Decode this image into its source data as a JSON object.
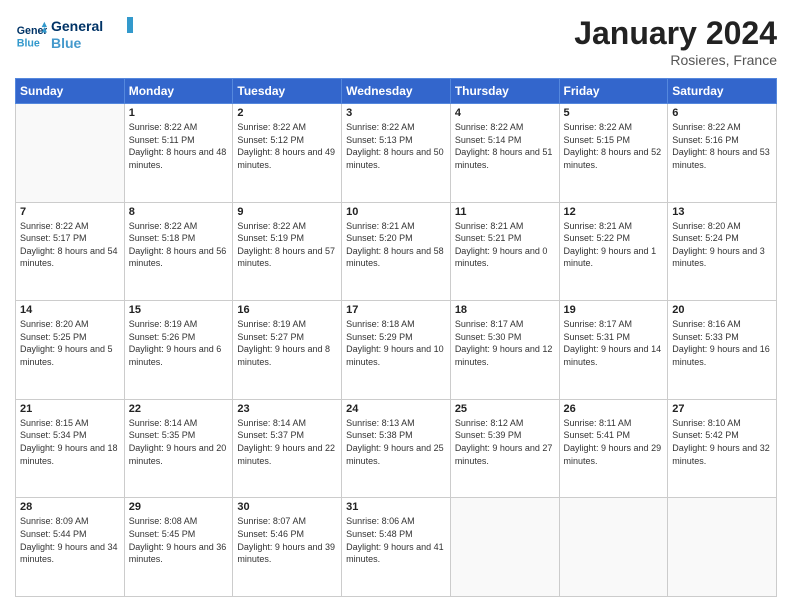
{
  "logo": {
    "line1": "General",
    "line2": "Blue"
  },
  "header": {
    "title": "January 2024",
    "location": "Rosieres, France"
  },
  "days_of_week": [
    "Sunday",
    "Monday",
    "Tuesday",
    "Wednesday",
    "Thursday",
    "Friday",
    "Saturday"
  ],
  "weeks": [
    [
      {
        "day": "",
        "sunrise": "",
        "sunset": "",
        "daylight": ""
      },
      {
        "day": "1",
        "sunrise": "Sunrise: 8:22 AM",
        "sunset": "Sunset: 5:11 PM",
        "daylight": "Daylight: 8 hours and 48 minutes."
      },
      {
        "day": "2",
        "sunrise": "Sunrise: 8:22 AM",
        "sunset": "Sunset: 5:12 PM",
        "daylight": "Daylight: 8 hours and 49 minutes."
      },
      {
        "day": "3",
        "sunrise": "Sunrise: 8:22 AM",
        "sunset": "Sunset: 5:13 PM",
        "daylight": "Daylight: 8 hours and 50 minutes."
      },
      {
        "day": "4",
        "sunrise": "Sunrise: 8:22 AM",
        "sunset": "Sunset: 5:14 PM",
        "daylight": "Daylight: 8 hours and 51 minutes."
      },
      {
        "day": "5",
        "sunrise": "Sunrise: 8:22 AM",
        "sunset": "Sunset: 5:15 PM",
        "daylight": "Daylight: 8 hours and 52 minutes."
      },
      {
        "day": "6",
        "sunrise": "Sunrise: 8:22 AM",
        "sunset": "Sunset: 5:16 PM",
        "daylight": "Daylight: 8 hours and 53 minutes."
      }
    ],
    [
      {
        "day": "7",
        "sunrise": "Sunrise: 8:22 AM",
        "sunset": "Sunset: 5:17 PM",
        "daylight": "Daylight: 8 hours and 54 minutes."
      },
      {
        "day": "8",
        "sunrise": "Sunrise: 8:22 AM",
        "sunset": "Sunset: 5:18 PM",
        "daylight": "Daylight: 8 hours and 56 minutes."
      },
      {
        "day": "9",
        "sunrise": "Sunrise: 8:22 AM",
        "sunset": "Sunset: 5:19 PM",
        "daylight": "Daylight: 8 hours and 57 minutes."
      },
      {
        "day": "10",
        "sunrise": "Sunrise: 8:21 AM",
        "sunset": "Sunset: 5:20 PM",
        "daylight": "Daylight: 8 hours and 58 minutes."
      },
      {
        "day": "11",
        "sunrise": "Sunrise: 8:21 AM",
        "sunset": "Sunset: 5:21 PM",
        "daylight": "Daylight: 9 hours and 0 minutes."
      },
      {
        "day": "12",
        "sunrise": "Sunrise: 8:21 AM",
        "sunset": "Sunset: 5:22 PM",
        "daylight": "Daylight: 9 hours and 1 minute."
      },
      {
        "day": "13",
        "sunrise": "Sunrise: 8:20 AM",
        "sunset": "Sunset: 5:24 PM",
        "daylight": "Daylight: 9 hours and 3 minutes."
      }
    ],
    [
      {
        "day": "14",
        "sunrise": "Sunrise: 8:20 AM",
        "sunset": "Sunset: 5:25 PM",
        "daylight": "Daylight: 9 hours and 5 minutes."
      },
      {
        "day": "15",
        "sunrise": "Sunrise: 8:19 AM",
        "sunset": "Sunset: 5:26 PM",
        "daylight": "Daylight: 9 hours and 6 minutes."
      },
      {
        "day": "16",
        "sunrise": "Sunrise: 8:19 AM",
        "sunset": "Sunset: 5:27 PM",
        "daylight": "Daylight: 9 hours and 8 minutes."
      },
      {
        "day": "17",
        "sunrise": "Sunrise: 8:18 AM",
        "sunset": "Sunset: 5:29 PM",
        "daylight": "Daylight: 9 hours and 10 minutes."
      },
      {
        "day": "18",
        "sunrise": "Sunrise: 8:17 AM",
        "sunset": "Sunset: 5:30 PM",
        "daylight": "Daylight: 9 hours and 12 minutes."
      },
      {
        "day": "19",
        "sunrise": "Sunrise: 8:17 AM",
        "sunset": "Sunset: 5:31 PM",
        "daylight": "Daylight: 9 hours and 14 minutes."
      },
      {
        "day": "20",
        "sunrise": "Sunrise: 8:16 AM",
        "sunset": "Sunset: 5:33 PM",
        "daylight": "Daylight: 9 hours and 16 minutes."
      }
    ],
    [
      {
        "day": "21",
        "sunrise": "Sunrise: 8:15 AM",
        "sunset": "Sunset: 5:34 PM",
        "daylight": "Daylight: 9 hours and 18 minutes."
      },
      {
        "day": "22",
        "sunrise": "Sunrise: 8:14 AM",
        "sunset": "Sunset: 5:35 PM",
        "daylight": "Daylight: 9 hours and 20 minutes."
      },
      {
        "day": "23",
        "sunrise": "Sunrise: 8:14 AM",
        "sunset": "Sunset: 5:37 PM",
        "daylight": "Daylight: 9 hours and 22 minutes."
      },
      {
        "day": "24",
        "sunrise": "Sunrise: 8:13 AM",
        "sunset": "Sunset: 5:38 PM",
        "daylight": "Daylight: 9 hours and 25 minutes."
      },
      {
        "day": "25",
        "sunrise": "Sunrise: 8:12 AM",
        "sunset": "Sunset: 5:39 PM",
        "daylight": "Daylight: 9 hours and 27 minutes."
      },
      {
        "day": "26",
        "sunrise": "Sunrise: 8:11 AM",
        "sunset": "Sunset: 5:41 PM",
        "daylight": "Daylight: 9 hours and 29 minutes."
      },
      {
        "day": "27",
        "sunrise": "Sunrise: 8:10 AM",
        "sunset": "Sunset: 5:42 PM",
        "daylight": "Daylight: 9 hours and 32 minutes."
      }
    ],
    [
      {
        "day": "28",
        "sunrise": "Sunrise: 8:09 AM",
        "sunset": "Sunset: 5:44 PM",
        "daylight": "Daylight: 9 hours and 34 minutes."
      },
      {
        "day": "29",
        "sunrise": "Sunrise: 8:08 AM",
        "sunset": "Sunset: 5:45 PM",
        "daylight": "Daylight: 9 hours and 36 minutes."
      },
      {
        "day": "30",
        "sunrise": "Sunrise: 8:07 AM",
        "sunset": "Sunset: 5:46 PM",
        "daylight": "Daylight: 9 hours and 39 minutes."
      },
      {
        "day": "31",
        "sunrise": "Sunrise: 8:06 AM",
        "sunset": "Sunset: 5:48 PM",
        "daylight": "Daylight: 9 hours and 41 minutes."
      },
      {
        "day": "",
        "sunrise": "",
        "sunset": "",
        "daylight": ""
      },
      {
        "day": "",
        "sunrise": "",
        "sunset": "",
        "daylight": ""
      },
      {
        "day": "",
        "sunrise": "",
        "sunset": "",
        "daylight": ""
      }
    ]
  ]
}
